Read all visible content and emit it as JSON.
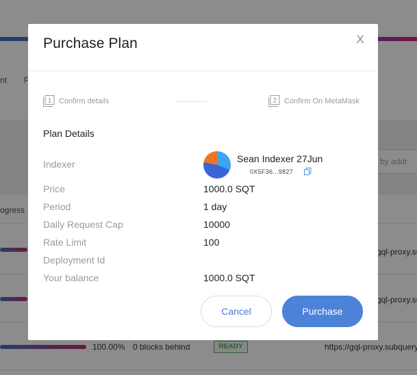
{
  "background": {
    "tab_fragment_1": "nt",
    "tab_fragment_2": "P",
    "progress_header": "ogress",
    "search_placeholder": "ch by addr",
    "rows": [
      {
        "link": "gql-proxy.subquery"
      },
      {
        "link": "gql-proxy.subquery"
      },
      {
        "link": "https://gql-proxy.subquery",
        "progress_text": "100.00%",
        "blocks_behind": "0 blocks behind",
        "status": "READY"
      }
    ],
    "colors": {
      "ready": "#5da35d",
      "progress_start": "#4470c4",
      "progress_end": "#c0306c"
    }
  },
  "modal": {
    "title": "Purchase Plan",
    "close_label": "X",
    "steps": [
      {
        "number": "1",
        "label": "Confirm details",
        "icon": "step-1-icon"
      },
      {
        "number": "2",
        "label": "Confirm On MetaMask",
        "icon": "step-2-icon"
      }
    ],
    "section_title": "Plan Details",
    "indexer": {
      "label": "Indexer",
      "name": "Sean Indexer 27Jun",
      "address": "0X5F36...9827",
      "avatar_icon": "indexer-avatar-icon",
      "copy_icon": "copy-icon"
    },
    "details": [
      {
        "label": "Price",
        "value": "1000.0 SQT"
      },
      {
        "label": "Period",
        "value": "1 day"
      },
      {
        "label": "Daily Request Cap",
        "value": "10000"
      },
      {
        "label": "Rate Limit",
        "value": "100"
      },
      {
        "label": "Deployment Id",
        "value": ""
      },
      {
        "label": "Your balance",
        "value": "1000.0 SQT"
      }
    ],
    "buttons": {
      "cancel": "Cancel",
      "purchase": "Purchase"
    },
    "colors": {
      "accent": "#4d82d9",
      "label_gray": "#9a9a9a"
    }
  }
}
